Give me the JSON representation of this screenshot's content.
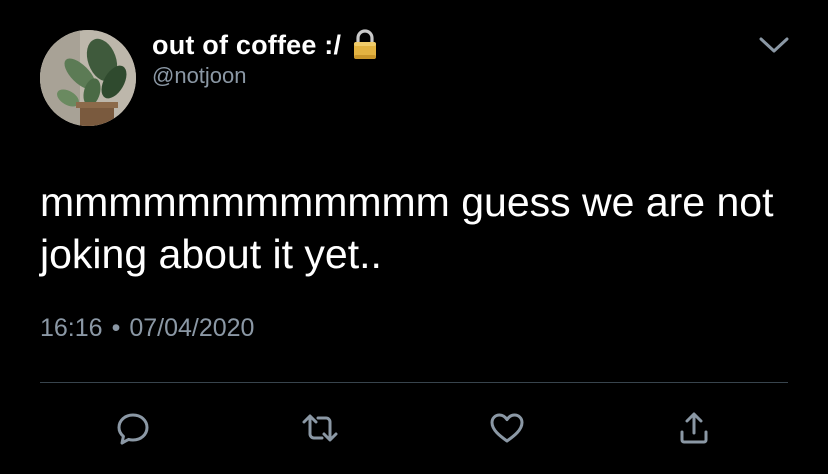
{
  "author": {
    "display_name": "out of coffee :/",
    "handle": "@notjoon",
    "avatar_icon": "avatar-plant-photo",
    "protected_icon": "lock-icon"
  },
  "tweet": {
    "text": "mmmmmmmmmmmm guess we are not\njoking about it yet..",
    "time": "16:16",
    "separator": "•",
    "date": "07/04/2020"
  },
  "menu": {
    "icon": "chevron-down-icon"
  },
  "actions": [
    {
      "name": "reply",
      "icon": "reply-icon"
    },
    {
      "name": "retweet",
      "icon": "retweet-icon"
    },
    {
      "name": "like",
      "icon": "heart-icon"
    },
    {
      "name": "share",
      "icon": "share-icon"
    }
  ],
  "colors": {
    "background": "#000000",
    "primary_text": "#ffffff",
    "secondary_text": "#8b98a5",
    "divider": "#38444d",
    "icon": "#8b98a5",
    "lock_gold": "#e3b341"
  }
}
